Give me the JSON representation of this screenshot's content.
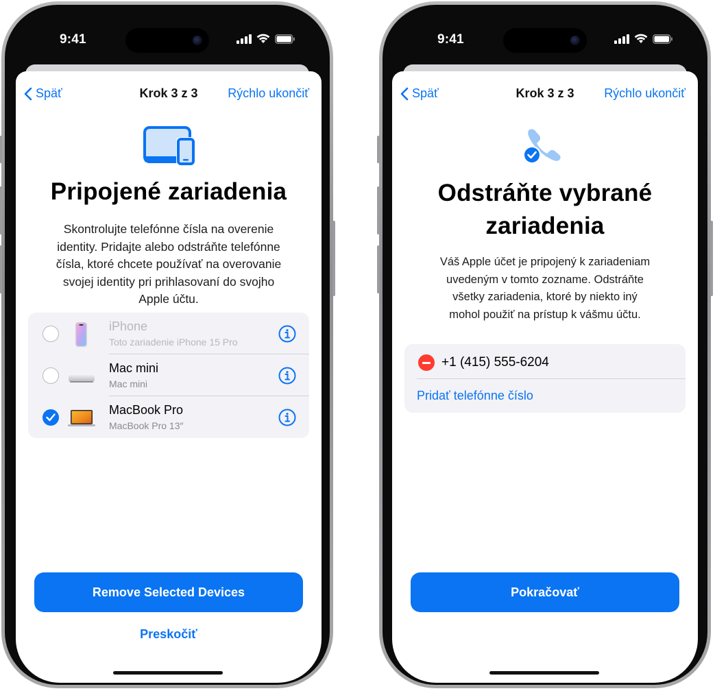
{
  "left_phone": {
    "status_time": "9:41",
    "nav": {
      "back_label": "Späť",
      "title": "Krok 3 z 3",
      "quick_exit": "Rýchlo ukončiť"
    },
    "icon": "devices-icon",
    "heading": "Pripojené zariadenia",
    "description_lines": [
      "Skontrolujte telefónne čísla na overenie",
      "identity. Pridajte alebo odstráňte telefónne",
      "čísla, ktoré chcete používať na overovanie",
      "svojej identity pri prihlasovaní do svojho",
      "Apple účtu."
    ],
    "devices": [
      {
        "name": "iPhone",
        "subtitle": "Toto zariadenie iPhone 15 Pro",
        "selected": false,
        "dimmed": true,
        "icon": "iphone-icon"
      },
      {
        "name": "Mac mini",
        "subtitle": "Mac mini",
        "selected": false,
        "dimmed": false,
        "icon": "mac-mini-icon"
      },
      {
        "name": "MacBook Pro",
        "subtitle": "MacBook Pro 13″",
        "selected": true,
        "dimmed": false,
        "icon": "macbook-icon"
      }
    ],
    "primary_button": "Remove Selected Devices",
    "secondary_link": "Preskočiť"
  },
  "right_phone": {
    "status_time": "9:41",
    "nav": {
      "back_label": "Späť",
      "title": "Krok 3 z 3",
      "quick_exit": "Rýchlo ukončiť"
    },
    "icon": "phone-checkmark-icon",
    "heading_lines": [
      "Odstráňte vybrané",
      "zariadenia"
    ],
    "description_lines": [
      "Váš Apple účet je pripojený k zariadeniam",
      "uvedeným v tomto zozname. Odstráňte",
      "všetky zariadenia, ktoré by niekto iný",
      "mohol použiť na prístup k vášmu účtu."
    ],
    "phone_number": "+1 (415) 555-6204",
    "add_phone_label": "Pridať telefónne číslo",
    "primary_button": "Pokračovať"
  },
  "colors": {
    "accent": "#0a74f2",
    "destructive": "#ff3b30",
    "list_background": "#f2f2f7"
  }
}
